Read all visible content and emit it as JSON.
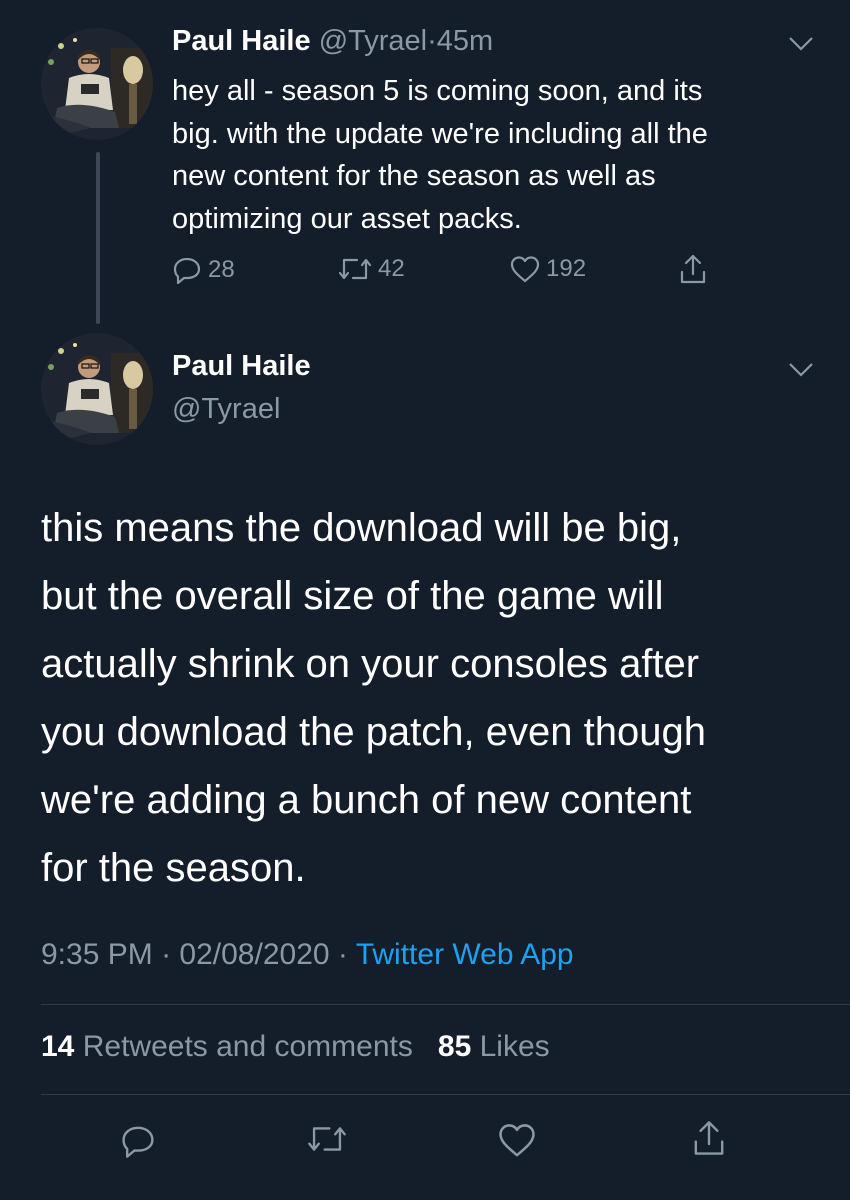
{
  "tweet_reply": {
    "author_name": "Paul Haile",
    "handle": "@Tyrael",
    "time_sep": "·",
    "time": "45m",
    "text": "hey all - season 5 is coming soon, and its\nbig.  with the update we're including all the\nnew content for the season as well as\noptimizing our asset packs.",
    "actions": {
      "reply_count": "28",
      "retweet_count": "42",
      "like_count": "192"
    }
  },
  "main_tweet": {
    "author_name": "Paul Haile",
    "handle": "@Tyrael",
    "text": "this means the download will be big,\nbut the overall size of the game will\nactually shrink on your consoles after\nyou download the patch, even though\nwe're adding a bunch of new content\nfor the season.",
    "time": "9:35 PM",
    "sep1": "·",
    "date": "02/08/2020",
    "sep2": "·",
    "source": "Twitter Web App",
    "retweets_count": "14",
    "retweets_label": "Retweets and comments",
    "likes_count": "85",
    "likes_label": "Likes"
  },
  "icons": {
    "reply": "reply-icon",
    "retweet": "retweet-icon",
    "like": "heart-icon",
    "share": "share-icon",
    "more": "chevron-down-icon"
  },
  "colors": {
    "background": "#141d2a",
    "muted_text": "#8b98a5",
    "link": "#1da1f2",
    "thread_line": "#3d4756"
  }
}
